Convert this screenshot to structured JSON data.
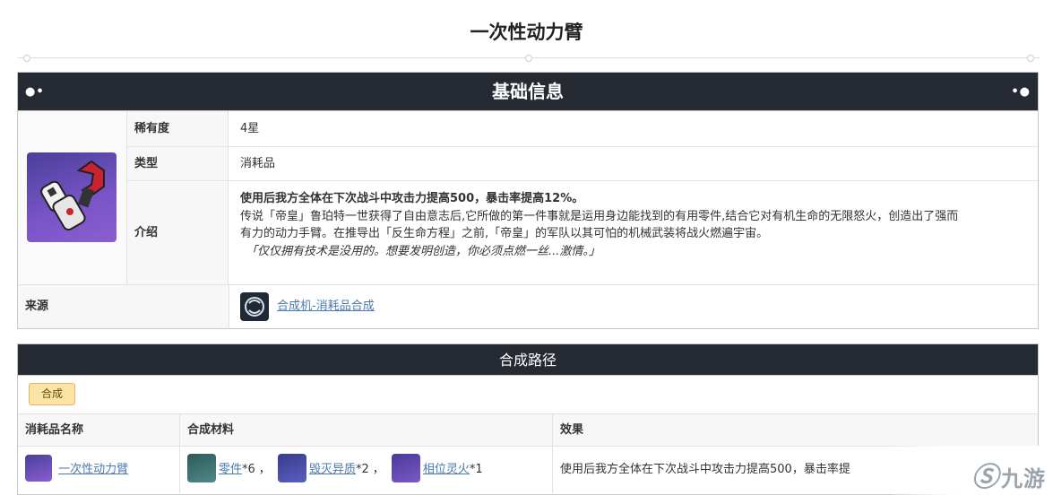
{
  "page": {
    "title": "一次性动力臂"
  },
  "info": {
    "header": "基础信息",
    "rarity_label": "稀有度",
    "rarity_value": "4星",
    "type_label": "类型",
    "type_value": "消耗品",
    "intro_label": "介绍",
    "intro_effect": "使用后我方全体在下次战斗中攻击力提高500，暴击率提高12%。",
    "intro_line1": "传说「帝皇」鲁珀特一世获得了自由意志后,它所做的第一件事就是运用身边能找到的有用零件,结合它对有机生命的无限怒火，创造出了强而",
    "intro_line2": "有力的动力手臂。在推导出「反生命方程」之前,「帝皇」的军队以其可怕的机械武装将战火燃遍宇宙。",
    "intro_quote": "「仅仅拥有技术是没用的。想要发明创造，你必须点燃一丝...激情。」",
    "source_label": "来源",
    "source_link": "合成机-消耗品合成"
  },
  "synthesis": {
    "header": "合成路径",
    "tab_label": "合成",
    "columns": [
      "消耗品名称",
      "合成材料",
      "效果"
    ],
    "rows": [
      {
        "name": "一次性动力臂",
        "materials": [
          {
            "name": "零件",
            "qty": "*6",
            "icon": "gear-part-icon"
          },
          {
            "name": "毁灭异质",
            "qty": "*2",
            "icon": "fire-essence-icon"
          },
          {
            "name": "相位灵火",
            "qty": "*1",
            "icon": "phase-flame-icon"
          }
        ],
        "material_separator": "，",
        "effect": "使用后我方全体在下次战斗中攻击力提高500，暴击率提"
      }
    ]
  },
  "watermark": {
    "text": "九游"
  }
}
